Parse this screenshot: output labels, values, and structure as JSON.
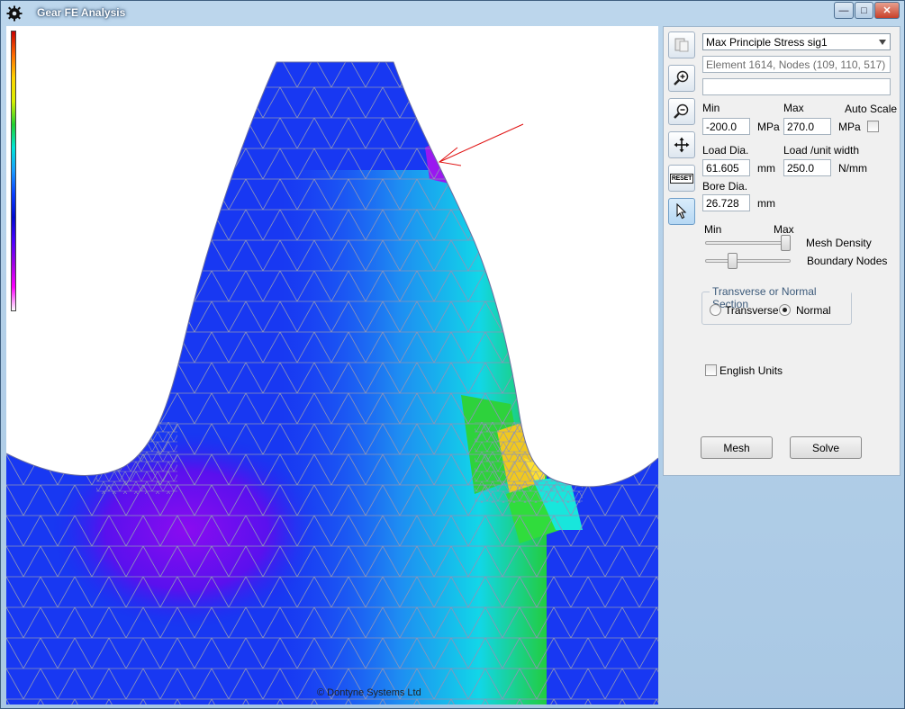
{
  "window": {
    "title": "Gear FE Analysis",
    "controls": {
      "minimize": "—",
      "maximize": "□",
      "close": "✕"
    }
  },
  "canvas": {
    "copyright": "© Dontyne Systems Ltd",
    "colorbar_colors": [
      "#c80000",
      "#ff6a00",
      "#ffd400",
      "#22d030",
      "#00e6d8",
      "#1a9cff",
      "#0a3fff",
      "#000ad0",
      "#a000e6",
      "#ff00ff",
      "#ffffff"
    ]
  },
  "toolbar": {
    "buttons": [
      {
        "name": "copy-view",
        "icon": "document-icon"
      },
      {
        "name": "zoom-in",
        "icon": "zoom-in-icon"
      },
      {
        "name": "zoom-out",
        "icon": "zoom-out-icon"
      },
      {
        "name": "pan",
        "icon": "move-icon"
      },
      {
        "name": "reset",
        "icon": "reset-icon",
        "label": "RESET"
      },
      {
        "name": "select",
        "icon": "cursor-icon"
      }
    ]
  },
  "panel": {
    "result_type": "Max Principle Stress sig1",
    "element_info": "Element 1614, Nodes (109, 110, 517)",
    "extra_field": "",
    "min_label": "Min",
    "max_label": "Max",
    "auto_scale_label": "Auto Scale",
    "min_value": "-200.0",
    "max_value": "270.0",
    "mpa_unit_1": "MPa",
    "mpa_unit_2": "MPa",
    "load_dia_label": "Load Dia.",
    "load_dia_value": "61.605",
    "load_dia_unit": "mm",
    "load_width_label": "Load /unit width",
    "load_width_value": "250.0",
    "load_width_unit": "N/mm",
    "bore_dia_label": "Bore Dia.",
    "bore_dia_value": "26.728",
    "bore_dia_unit": "mm",
    "slider_min_label": "Min",
    "slider_max_label": "Max",
    "mesh_density_label": "Mesh Density",
    "boundary_nodes_label": "Boundary Nodes",
    "mesh_density_level": 1.0,
    "boundary_nodes_level": 0.3,
    "section_group_title": "Transverse or Normal Section",
    "transverse_label": "Transverse",
    "normal_label": "Normal",
    "selected_section": "Normal",
    "english_units_label": "English Units",
    "english_units_checked": false,
    "auto_scale_checked": false,
    "mesh_button": "Mesh",
    "solve_button": "Solve"
  }
}
